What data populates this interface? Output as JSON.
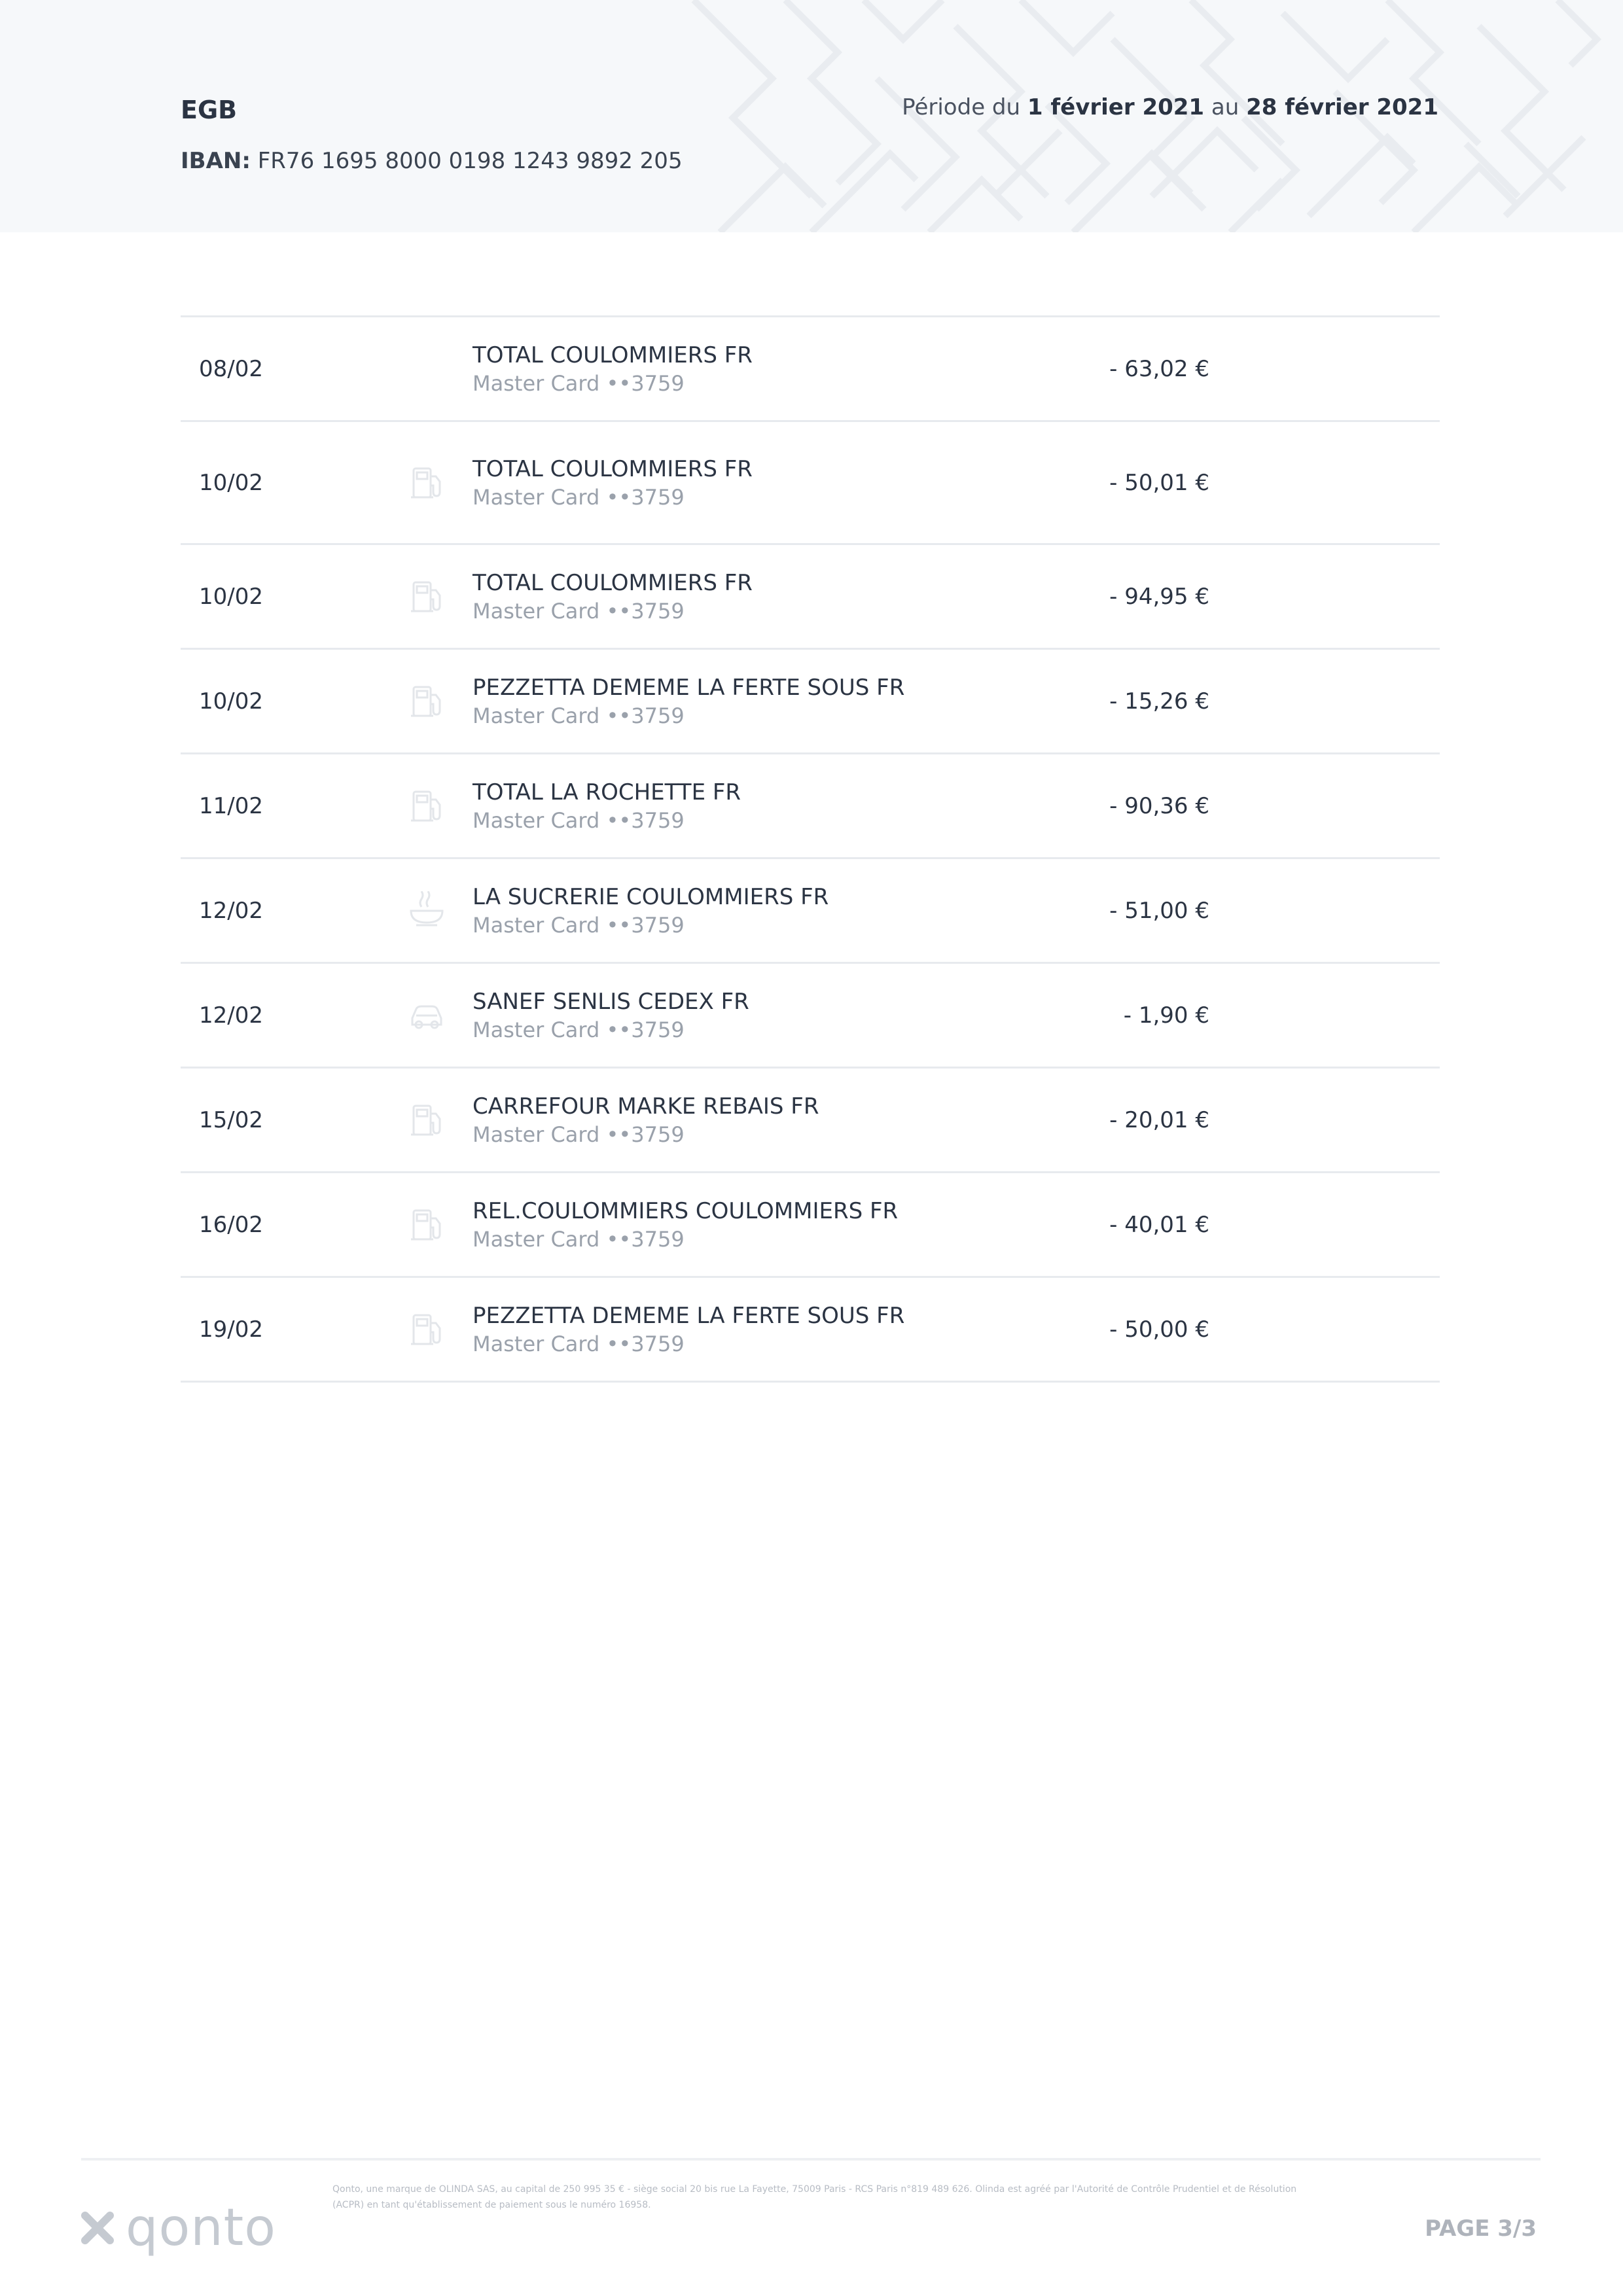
{
  "header": {
    "company": "EGB",
    "iban_label": "IBAN:",
    "iban_value": "FR76 1695 8000 0198 1243 9892 205",
    "period_prefix": "Période du",
    "period_start": "1 février 2021",
    "period_mid": "au",
    "period_end": "28 février 2021"
  },
  "transactions": [
    {
      "date": "08/02",
      "label": "TOTAL COULOMMIERS FR",
      "card": "Master Card ••3759",
      "amount": "- 63,02 €",
      "icon": "none"
    },
    {
      "date": "10/02",
      "label": "TOTAL COULOMMIERS FR",
      "card": "Master Card ••3759",
      "amount": "- 50,01 €",
      "icon": "fuel-pump-icon"
    },
    {
      "date": "10/02",
      "label": "TOTAL COULOMMIERS FR",
      "card": "Master Card ••3759",
      "amount": "- 94,95 €",
      "icon": "fuel-pump-icon"
    },
    {
      "date": "10/02",
      "label": "PEZZETTA DEMEME LA FERTE SOUS FR",
      "card": "Master Card ••3759",
      "amount": "- 15,26 €",
      "icon": "fuel-pump-icon"
    },
    {
      "date": "11/02",
      "label": "TOTAL LA ROCHETTE FR",
      "card": "Master Card ••3759",
      "amount": "- 90,36 €",
      "icon": "fuel-pump-icon"
    },
    {
      "date": "12/02",
      "label": "LA SUCRERIE COULOMMIERS FR",
      "card": "Master Card ••3759",
      "amount": "- 51,00 €",
      "icon": "food-bowl-icon"
    },
    {
      "date": "12/02",
      "label": "SANEF SENLIS CEDEX FR",
      "card": "Master Card ••3759",
      "amount": "- 1,90 €",
      "icon": "car-icon"
    },
    {
      "date": "15/02",
      "label": "CARREFOUR MARKE REBAIS FR",
      "card": "Master Card ••3759",
      "amount": "- 20,01 €",
      "icon": "fuel-pump-icon"
    },
    {
      "date": "16/02",
      "label": "REL.COULOMMIERS COULOMMIERS FR",
      "card": "Master Card ••3759",
      "amount": "- 40,01 €",
      "icon": "fuel-pump-icon"
    },
    {
      "date": "19/02",
      "label": "PEZZETTA DEMEME LA FERTE SOUS FR",
      "card": "Master Card ••3759",
      "amount": "- 50,00 €",
      "icon": "fuel-pump-icon"
    }
  ],
  "footer": {
    "logo_text": "qonto",
    "legal": "Qonto, une marque de OLINDA SAS, au capital de 250 995 35 € - siège social 20 bis rue La Fayette, 75009 Paris - RCS Paris n°819 489 626. Olinda est agréé par l'Autorité de Contrôle Prudentiel et de Résolution (ACPR) en tant qu'établissement de paiement sous le numéro 16958.",
    "page": "PAGE 3/3"
  }
}
